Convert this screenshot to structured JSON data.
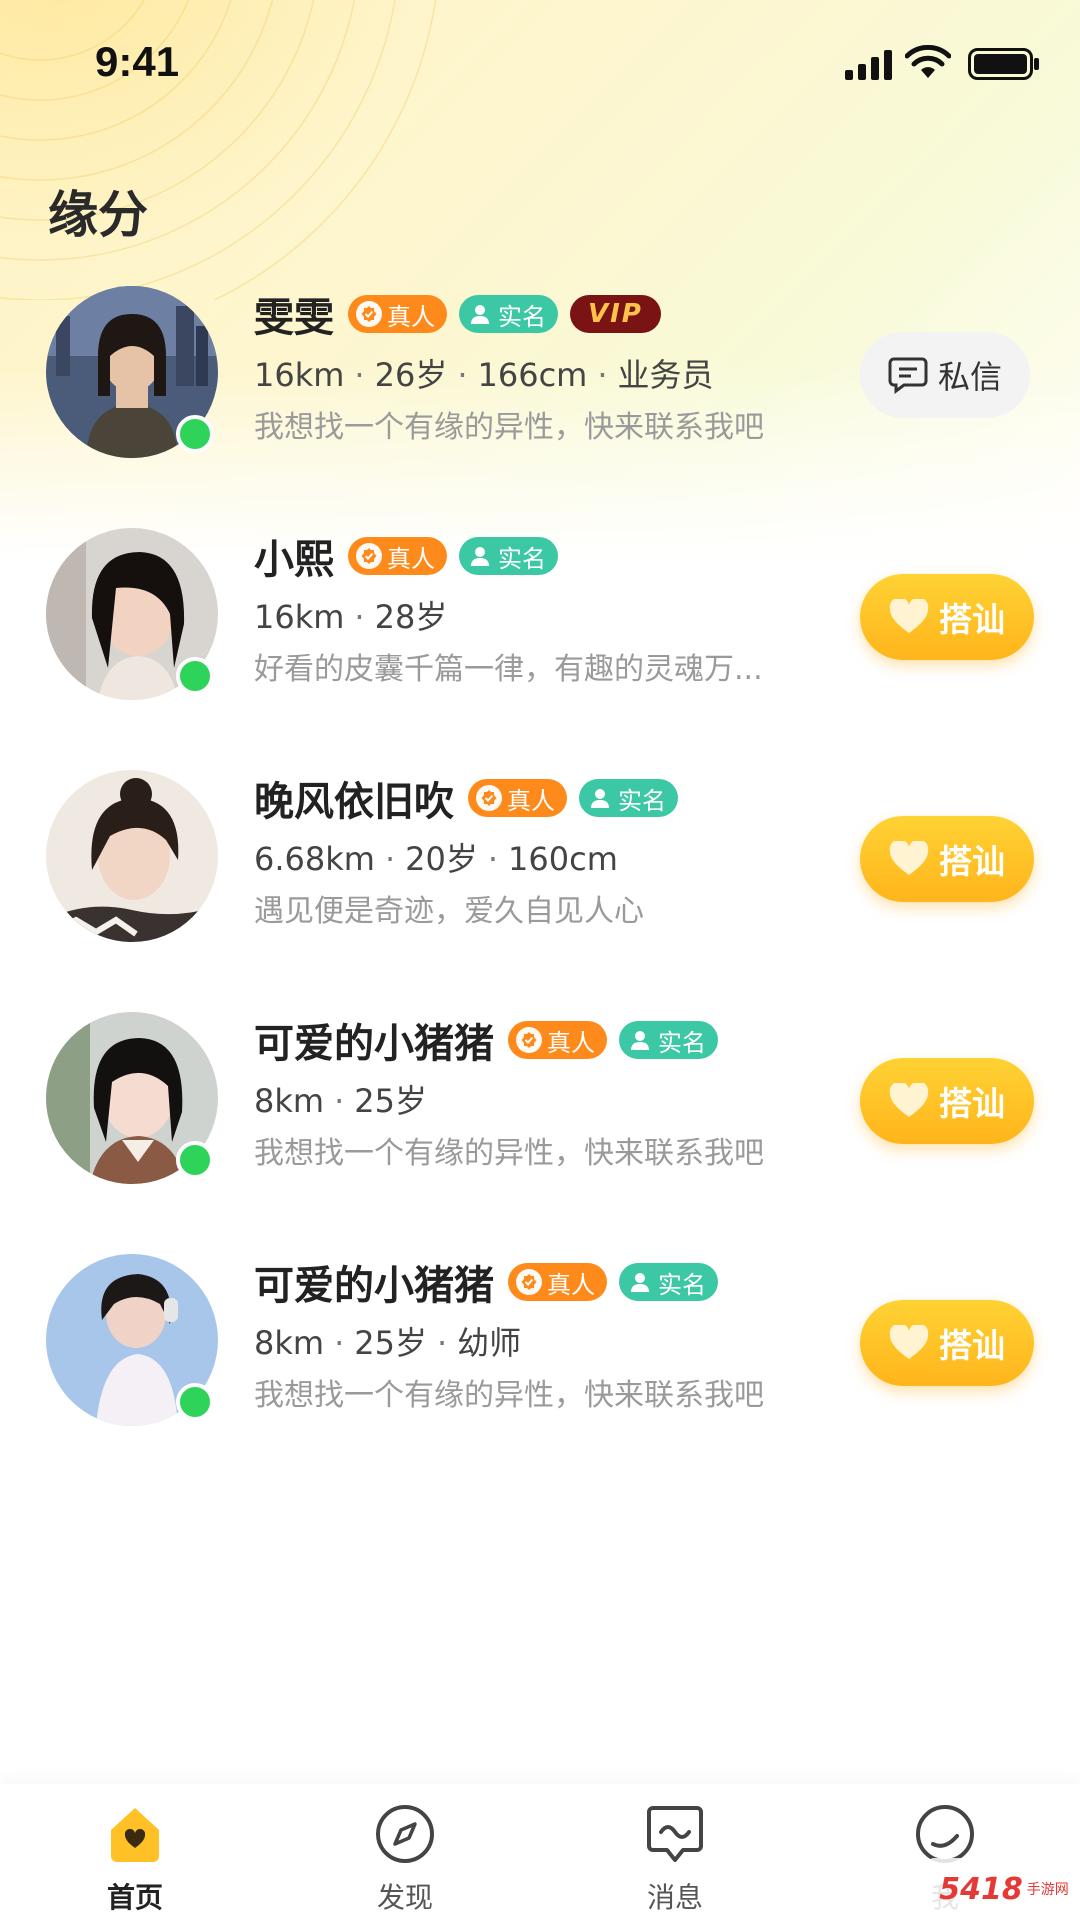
{
  "status_bar": {
    "time": "9:41"
  },
  "page": {
    "title": "缘分"
  },
  "users": [
    {
      "name": "雯雯",
      "badges": {
        "real": "真人",
        "verified": "实名",
        "vip": "VIP"
      },
      "distance": "16km",
      "age": "26岁",
      "height": "166cm",
      "job": "业务员",
      "bio": "我想找一个有缘的异性，快来联系我吧",
      "online": true,
      "action": "私信"
    },
    {
      "name": "小熙",
      "badges": {
        "real": "真人",
        "verified": "实名"
      },
      "distance": "16km",
      "age": "28岁",
      "bio": "好看的皮囊千篇一律，有趣的灵魂万...",
      "online": true,
      "action": "搭讪"
    },
    {
      "name": "晚风依旧吹",
      "badges": {
        "real": "真人",
        "verified": "实名"
      },
      "distance": "6.68km",
      "age": "20岁",
      "height": "160cm",
      "bio": "遇见便是奇迹，爱久自见人心",
      "online": false,
      "action": "搭讪"
    },
    {
      "name": "可爱的小猪猪",
      "badges": {
        "real": "真人",
        "verified": "实名"
      },
      "distance": "8km",
      "age": "25岁",
      "bio": "我想找一个有缘的异性，快来联系我吧",
      "online": true,
      "action": "搭讪"
    },
    {
      "name": "可爱的小猪猪",
      "badges": {
        "real": "真人",
        "verified": "实名"
      },
      "distance": "8km",
      "age": "25岁",
      "job": "幼师",
      "bio": "我想找一个有缘的异性，快来联系我吧",
      "online": true,
      "action": "搭讪"
    }
  ],
  "tabbar": {
    "home": "首页",
    "discover": "发现",
    "messages": "消息",
    "me": "我"
  },
  "watermark": {
    "text": "5418",
    "sub": "手游网"
  },
  "colors": {
    "accent": "#ffc125",
    "real_badge": "#ff8a1c",
    "verified_badge": "#3cc8a4",
    "vip_badge": "#7a1414",
    "online": "#2ed35a"
  }
}
